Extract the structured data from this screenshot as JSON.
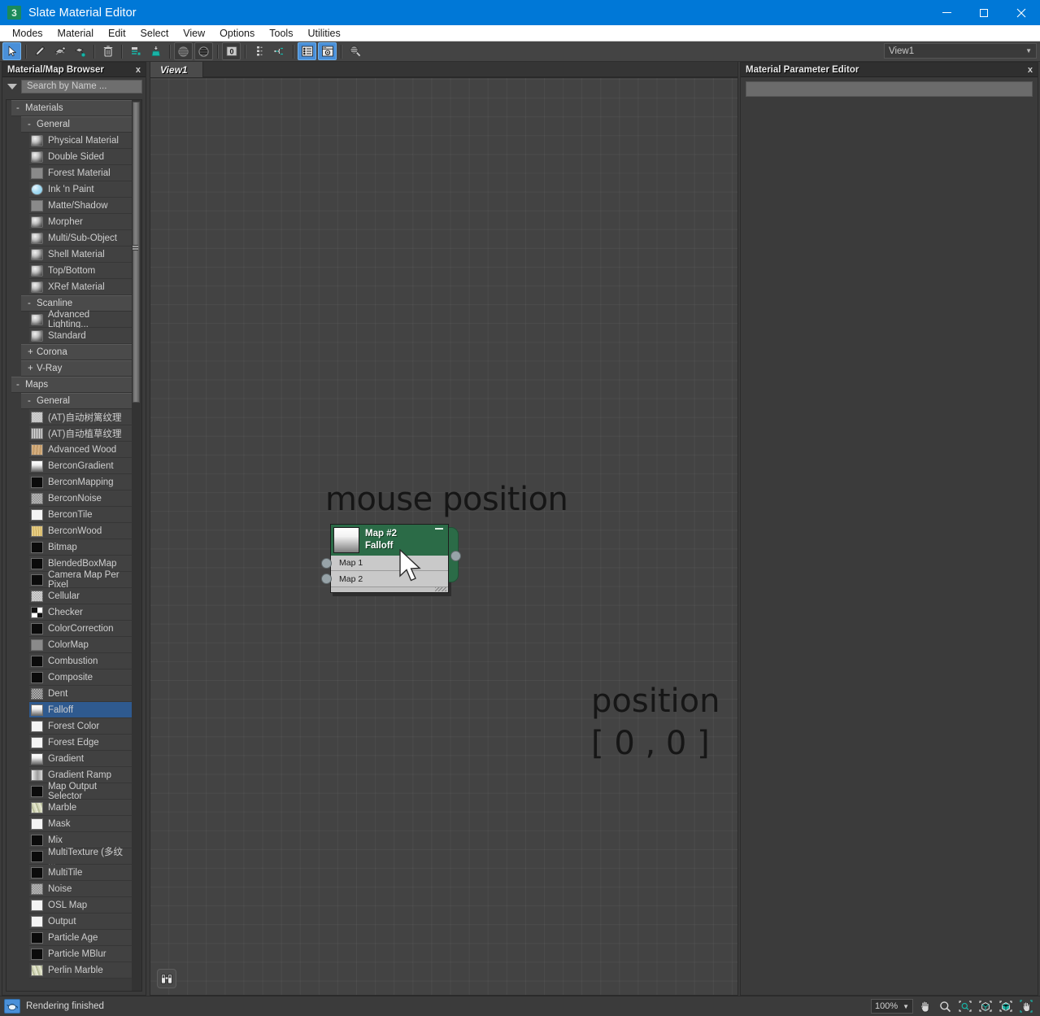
{
  "window": {
    "title": "Slate Material Editor",
    "app_badge": "3",
    "minimize": "minimize-button",
    "maximize": "maximize-button",
    "close": "close-button"
  },
  "menubar": {
    "items": [
      "Modes",
      "Material",
      "Edit",
      "Select",
      "View",
      "Options",
      "Tools",
      "Utilities"
    ]
  },
  "toolbar": {
    "buttons": [
      {
        "name": "select-tool",
        "icon": "arrow-cursor-icon",
        "active": true
      },
      {
        "name": "pick-material-tool",
        "icon": "eyedropper-icon",
        "active": false
      },
      {
        "name": "assign-material-to-selection",
        "icon": "assign-material-icon",
        "active": false
      },
      {
        "name": "show-shaded-material-in-viewport",
        "icon": "material-swatch-icon",
        "active": false
      },
      {
        "name": "delete-selected",
        "icon": "trash-icon",
        "active": false
      },
      {
        "name": "move-children",
        "icon": "move-children-icon",
        "active": false
      },
      {
        "name": "put-material-to-scene",
        "icon": "put-to-scene-icon",
        "active": false
      },
      {
        "name": "show-background-in-preview",
        "icon": "checker-sphere-icon",
        "active": false
      },
      {
        "name": "show-background-dark",
        "icon": "checker-dark-icon",
        "active": false
      },
      {
        "name": "material-id-channel",
        "icon": "zero-id-icon",
        "active": false
      },
      {
        "name": "layout-children-vertical",
        "icon": "layout-vertical-icon",
        "active": false
      },
      {
        "name": "layout-all-children",
        "icon": "layout-branch-icon",
        "active": false
      },
      {
        "name": "toggle-material-map-browser",
        "icon": "browser-panel-icon",
        "active": true
      },
      {
        "name": "toggle-parameter-editor",
        "icon": "parameter-editor-icon",
        "active": true
      },
      {
        "name": "select-by-material",
        "icon": "select-by-material-icon",
        "active": false
      }
    ],
    "view_selector": {
      "value": "View1",
      "arrow": "chevron-down-icon"
    }
  },
  "browser": {
    "title": "Material/Map Browser",
    "close_label": "x",
    "search": {
      "placeholder": "Search by Name ...",
      "value": "",
      "filter_icon": "triangle-down-icon"
    },
    "tree": [
      {
        "type": "group",
        "level": 0,
        "sign": "-",
        "label": "Materials"
      },
      {
        "type": "group",
        "level": 1,
        "sign": "-",
        "label": "General"
      },
      {
        "type": "item",
        "label": "Physical Material",
        "swatch": "sphere-gray"
      },
      {
        "type": "item",
        "label": "Double Sided",
        "swatch": "sphere-gray"
      },
      {
        "type": "item",
        "label": "Forest Material",
        "swatch": "flat-gray"
      },
      {
        "type": "item",
        "label": "Ink 'n Paint",
        "swatch": "sphere-blue"
      },
      {
        "type": "item",
        "label": "Matte/Shadow",
        "swatch": "flat-gray"
      },
      {
        "type": "item",
        "label": "Morpher",
        "swatch": "sphere-gray"
      },
      {
        "type": "item",
        "label": "Multi/Sub-Object",
        "swatch": "sphere-gray"
      },
      {
        "type": "item",
        "label": "Shell Material",
        "swatch": "sphere-gray"
      },
      {
        "type": "item",
        "label": "Top/Bottom",
        "swatch": "sphere-gray"
      },
      {
        "type": "item",
        "label": "XRef Material",
        "swatch": "sphere-gray"
      },
      {
        "type": "group",
        "level": 1,
        "sign": "-",
        "label": "Scanline"
      },
      {
        "type": "item",
        "label": "Advanced Lighting...",
        "swatch": "sphere-gray"
      },
      {
        "type": "item",
        "label": "Standard",
        "swatch": "sphere-gray"
      },
      {
        "type": "group",
        "level": 1,
        "sign": "+",
        "label": "Corona"
      },
      {
        "type": "group",
        "level": 1,
        "sign": "+",
        "label": "V-Ray"
      },
      {
        "type": "group",
        "level": 0,
        "sign": "-",
        "label": "Maps"
      },
      {
        "type": "group",
        "level": 1,
        "sign": "-",
        "label": "General"
      },
      {
        "type": "item",
        "label": "(AT)自动树篱纹理",
        "swatch": "noise-light"
      },
      {
        "type": "item",
        "label": "(AT)自动植草纹理",
        "swatch": "streak-gray"
      },
      {
        "type": "item",
        "label": "Advanced Wood",
        "swatch": "wood-tan"
      },
      {
        "type": "item",
        "label": "BerconGradient",
        "swatch": "gradient-vert"
      },
      {
        "type": "item",
        "label": "BerconMapping",
        "swatch": "black"
      },
      {
        "type": "item",
        "label": "BerconNoise",
        "swatch": "noise-gray"
      },
      {
        "type": "item",
        "label": "BerconTile",
        "swatch": "white"
      },
      {
        "type": "item",
        "label": "BerconWood",
        "swatch": "wood-gold"
      },
      {
        "type": "item",
        "label": "Bitmap",
        "swatch": "black"
      },
      {
        "type": "item",
        "label": "BlendedBoxMap",
        "swatch": "black"
      },
      {
        "type": "item",
        "label": "Camera Map Per Pixel",
        "swatch": "black"
      },
      {
        "type": "item",
        "label": "Cellular",
        "swatch": "noise-speckle"
      },
      {
        "type": "item",
        "label": "Checker",
        "swatch": "checker"
      },
      {
        "type": "item",
        "label": "ColorCorrection",
        "swatch": "black"
      },
      {
        "type": "item",
        "label": "ColorMap",
        "swatch": "flat-gray"
      },
      {
        "type": "item",
        "label": "Combustion",
        "swatch": "black"
      },
      {
        "type": "item",
        "label": "Composite",
        "swatch": "black"
      },
      {
        "type": "item",
        "label": "Dent",
        "swatch": "noise-dent"
      },
      {
        "type": "item",
        "label": "Falloff",
        "swatch": "gradient-vert",
        "selected": true
      },
      {
        "type": "item",
        "label": "Forest Color",
        "swatch": "white"
      },
      {
        "type": "item",
        "label": "Forest Edge",
        "swatch": "white"
      },
      {
        "type": "item",
        "label": "Gradient",
        "swatch": "gradient-vert"
      },
      {
        "type": "item",
        "label": "Gradient Ramp",
        "swatch": "gradient-ramp"
      },
      {
        "type": "item",
        "label": "Map Output Selector",
        "swatch": "black"
      },
      {
        "type": "item",
        "label": "Marble",
        "swatch": "marble"
      },
      {
        "type": "item",
        "label": "Mask",
        "swatch": "white"
      },
      {
        "type": "item",
        "label": "Mix",
        "swatch": "black"
      },
      {
        "type": "item",
        "label": "MultiTexture (多纹 ...",
        "swatch": "black"
      },
      {
        "type": "item",
        "label": "MultiTile",
        "swatch": "black"
      },
      {
        "type": "item",
        "label": "Noise",
        "swatch": "noise-gray"
      },
      {
        "type": "item",
        "label": "OSL Map",
        "swatch": "white"
      },
      {
        "type": "item",
        "label": "Output",
        "swatch": "white"
      },
      {
        "type": "item",
        "label": "Particle Age",
        "swatch": "black"
      },
      {
        "type": "item",
        "label": "Particle MBlur",
        "swatch": "black"
      },
      {
        "type": "item",
        "label": "Perlin Marble",
        "swatch": "marble"
      }
    ]
  },
  "view": {
    "tabs": [
      {
        "label": "View1",
        "active": true
      }
    ],
    "annotations": {
      "mouse_position": "mouse position",
      "position_label": "position",
      "position_value": "[ 0 , 0 ]"
    },
    "node": {
      "title": "Map #2",
      "subtitle": "Falloff",
      "collapse_icon": "minus-icon",
      "inputs": [
        "Map 1",
        "Map 2"
      ],
      "output_socket": "output-socket",
      "header_color": "#2b6b47",
      "body_color": "#c9c9c9",
      "cursor_icon": "mouse-cursor-icon"
    },
    "navigator_button": "binoculars-icon"
  },
  "parameter_editor": {
    "title": "Material Parameter Editor",
    "close_label": "x",
    "field_value": ""
  },
  "statusbar": {
    "icon": "teapot-icon",
    "message": "Rendering finished",
    "zoom": {
      "value": "100%",
      "arrow": "chevron-down-icon"
    },
    "buttons": [
      {
        "name": "pan-view-button",
        "icon": "hand-icon"
      },
      {
        "name": "zoom-button",
        "icon": "magnifier-icon"
      },
      {
        "name": "zoom-region-button",
        "icon": "zoom-region-icon"
      },
      {
        "name": "zoom-extents-button",
        "icon": "zoom-extents-icon"
      },
      {
        "name": "zoom-extents-selected-button",
        "icon": "zoom-extents-selected-icon"
      },
      {
        "name": "pan-all-button",
        "icon": "pan-all-icon"
      }
    ]
  },
  "colors": {
    "accent": "#0078d7",
    "selection": "#2f5a8f",
    "node_header": "#2b6b47",
    "toolbar_active": "#4a90d9"
  }
}
